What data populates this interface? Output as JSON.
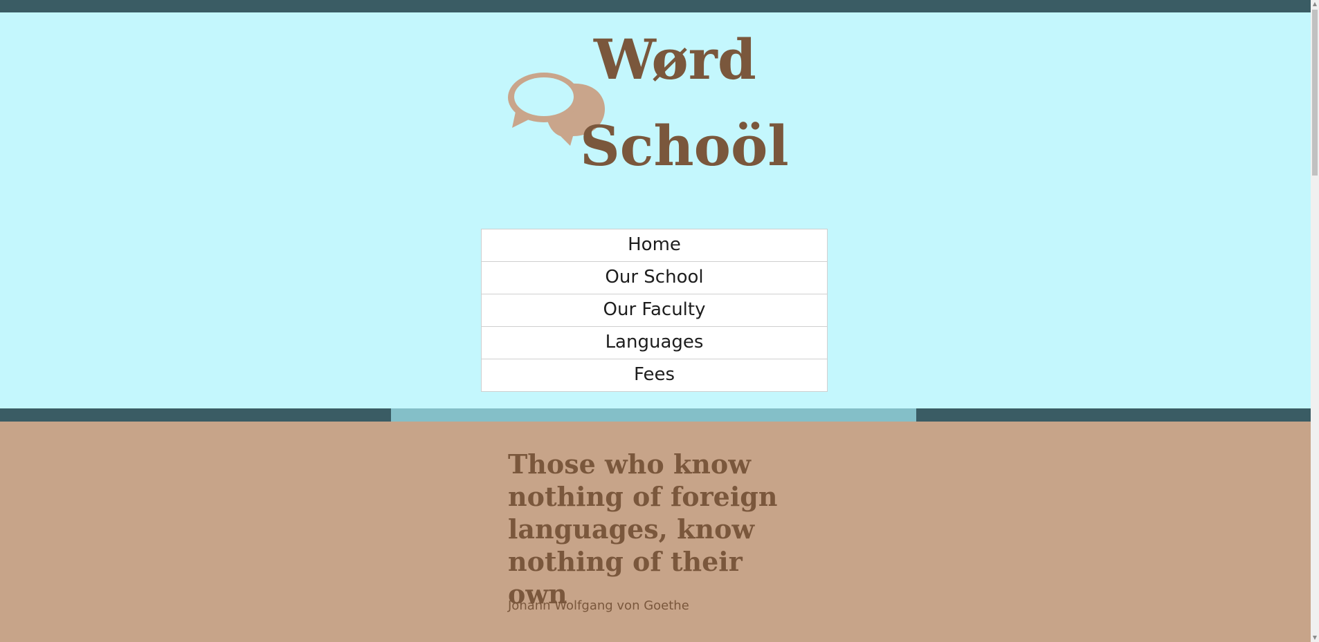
{
  "header": {
    "title_line1": "Wørd",
    "title_line2": "Schoöl",
    "logo_icon": "speech-bubbles-icon"
  },
  "nav": {
    "items": [
      {
        "label": "Home"
      },
      {
        "label": "Our School"
      },
      {
        "label": "Our Faculty"
      },
      {
        "label": "Languages"
      },
      {
        "label": "Fees"
      }
    ]
  },
  "quote": {
    "text": "Those who know nothing of foreign languages, know nothing of their own",
    "author": "Johann Wolfgang von Goethe"
  },
  "scrollbar": {
    "up_glyph": "▲",
    "down_glyph": "▼"
  },
  "colors": {
    "header_bg": "#c4f7fd",
    "bar_dark": "#3a5c64",
    "bar_accent": "#84bfc8",
    "brand_brown": "#7a573c",
    "logo_tan": "#c9a58b",
    "quote_bg": "#c7a489"
  }
}
